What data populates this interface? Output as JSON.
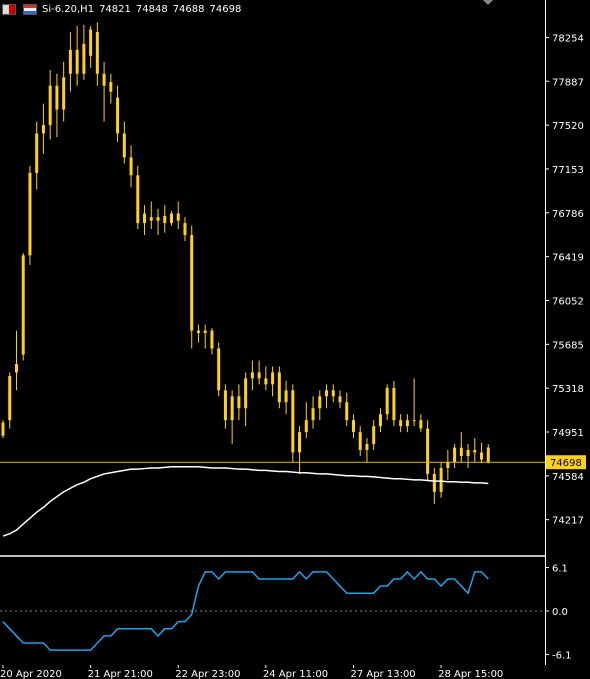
{
  "header": {
    "symbol": "Si-6.20,H1",
    "open": "74821",
    "high": "74848",
    "low": "74688",
    "close": "74698"
  },
  "colors": {
    "background": "#000000",
    "candle": "#ffd21a",
    "current_price_line": "#e6b800",
    "current_price_badge": "#ffd21a",
    "moving_average": "#ffffff",
    "indicator_line": "#1fa3e6",
    "axis_text": "#ffffff",
    "separator": "#ffffff"
  },
  "price_axis": {
    "ticks": [
      "78254",
      "77887",
      "77520",
      "77153",
      "76786",
      "76419",
      "76052",
      "75685",
      "75318",
      "74951",
      "74584",
      "74217"
    ],
    "current_price": "74698"
  },
  "indicator_axis": {
    "ticks": [
      "6.1",
      "0.0",
      "-6.1"
    ]
  },
  "time_axis": {
    "labels": [
      "20 Apr 2020",
      "21 Apr 21:00",
      "22 Apr 23:00",
      "24 Apr 11:00",
      "27 Apr 13:00",
      "28 Apr 15:00"
    ]
  },
  "chart_data": {
    "type": "candlestick",
    "timeframe": "H1",
    "ylim": [
      73980,
      78400
    ],
    "indicator_ylim": [
      -6.6,
      6.6
    ],
    "candles": [
      [
        74920,
        75050,
        74900,
        75030
      ],
      [
        75050,
        75450,
        74980,
        75420
      ],
      [
        75450,
        75800,
        75300,
        75520
      ],
      [
        75600,
        76450,
        75550,
        76430
      ],
      [
        76430,
        77180,
        76350,
        77120
      ],
      [
        77120,
        77550,
        76980,
        77450
      ],
      [
        77450,
        77700,
        77280,
        77520
      ],
      [
        77520,
        77980,
        77400,
        77850
      ],
      [
        77850,
        77950,
        77420,
        77650
      ],
      [
        77650,
        78050,
        77550,
        77920
      ],
      [
        77950,
        78300,
        77800,
        78150
      ],
      [
        78150,
        78350,
        77850,
        77950
      ],
      [
        77950,
        78360,
        77900,
        78200
      ],
      [
        78100,
        78350,
        78000,
        78320
      ],
      [
        78300,
        78380,
        77850,
        77950
      ],
      [
        77950,
        78050,
        77550,
        77850
      ],
      [
        77880,
        77950,
        77700,
        77800
      ],
      [
        77750,
        77850,
        77380,
        77450
      ],
      [
        77450,
        77550,
        77200,
        77250
      ],
      [
        77250,
        77350,
        77000,
        77100
      ],
      [
        77100,
        77180,
        76650,
        76700
      ],
      [
        76700,
        76850,
        76600,
        76780
      ],
      [
        76750,
        76880,
        76650,
        76720
      ],
      [
        76720,
        76820,
        76600,
        76750
      ],
      [
        76760,
        76850,
        76620,
        76700
      ],
      [
        76700,
        76800,
        76680,
        76780
      ],
      [
        76780,
        76880,
        76650,
        76720
      ],
      [
        76700,
        76750,
        76550,
        76600
      ],
      [
        76600,
        76680,
        75650,
        75800
      ],
      [
        75800,
        75850,
        75700,
        75780
      ],
      [
        75780,
        75850,
        75650,
        75800
      ],
      [
        75800,
        75820,
        75600,
        75650
      ],
      [
        75650,
        75700,
        75250,
        75300
      ],
      [
        75300,
        75350,
        74980,
        75050
      ],
      [
        75050,
        75300,
        74850,
        75250
      ],
      [
        75250,
        75350,
        75050,
        75150
      ],
      [
        75150,
        75450,
        75000,
        75400
      ],
      [
        75400,
        75550,
        75300,
        75450
      ],
      [
        75450,
        75550,
        75350,
        75400
      ],
      [
        75400,
        75500,
        75300,
        75350
      ],
      [
        75350,
        75500,
        75250,
        75450
      ],
      [
        75450,
        75500,
        75150,
        75200
      ],
      [
        75200,
        75380,
        75100,
        75300
      ],
      [
        75300,
        75350,
        74700,
        74780
      ],
      [
        74780,
        75000,
        74600,
        74950
      ],
      [
        74950,
        75200,
        74900,
        75050
      ],
      [
        75050,
        75250,
        74980,
        75150
      ],
      [
        75150,
        75300,
        75050,
        75250
      ],
      [
        75250,
        75350,
        75150,
        75300
      ],
      [
        75300,
        75350,
        75200,
        75250
      ],
      [
        75250,
        75300,
        75150,
        75200
      ],
      [
        75200,
        75280,
        75000,
        75050
      ],
      [
        75050,
        75100,
        74900,
        74950
      ],
      [
        74950,
        75000,
        74750,
        74800
      ],
      [
        74800,
        74900,
        74700,
        74850
      ],
      [
        74850,
        75050,
        74800,
        75000
      ],
      [
        75000,
        75150,
        74950,
        75100
      ],
      [
        75100,
        75350,
        75050,
        75320
      ],
      [
        75320,
        75380,
        75000,
        75050
      ],
      [
        75050,
        75100,
        74950,
        75000
      ],
      [
        75000,
        75100,
        74950,
        75050
      ],
      [
        75050,
        75400,
        75000,
        75050
      ],
      [
        75050,
        75100,
        74950,
        74980
      ],
      [
        74980,
        75050,
        74550,
        74600
      ],
      [
        74600,
        74650,
        74350,
        74450
      ],
      [
        74450,
        74700,
        74400,
        74650
      ],
      [
        74650,
        74800,
        74550,
        74700
      ],
      [
        74700,
        74850,
        74650,
        74820
      ],
      [
        74820,
        74950,
        74700,
        74750
      ],
      [
        74750,
        74850,
        74650,
        74800
      ],
      [
        74800,
        74900,
        74700,
        74780
      ],
      [
        74780,
        74860,
        74690,
        74720
      ],
      [
        74821,
        74848,
        74688,
        74698
      ]
    ],
    "moving_average": [
      74080,
      74100,
      74130,
      74180,
      74230,
      74280,
      74320,
      74370,
      74410,
      74450,
      74480,
      74510,
      74530,
      74560,
      74580,
      74600,
      74610,
      74620,
      74630,
      74640,
      74640,
      74645,
      74650,
      74650,
      74655,
      74660,
      74660,
      74660,
      74660,
      74660,
      74655,
      74650,
      74650,
      74650,
      74645,
      74640,
      74640,
      74635,
      74630,
      74630,
      74625,
      74620,
      74620,
      74615,
      74610,
      74610,
      74605,
      74600,
      74600,
      74595,
      74590,
      74585,
      74585,
      74580,
      74580,
      74575,
      74570,
      74565,
      74560,
      74560,
      74555,
      74550,
      74550,
      74545,
      74540,
      74540,
      74535,
      74535,
      74530,
      74530,
      74525,
      74525,
      74520
    ],
    "indicator_values": [
      -1.5,
      -2.5,
      -3.5,
      -4.5,
      -4.5,
      -4.5,
      -4.5,
      -5.5,
      -5.5,
      -5.5,
      -5.5,
      -5.5,
      -5.5,
      -5.5,
      -4.5,
      -3.5,
      -3.5,
      -2.5,
      -2.5,
      -2.5,
      -2.5,
      -2.5,
      -2.5,
      -3.5,
      -2.5,
      -2.5,
      -1.5,
      -1.5,
      -0.5,
      3.5,
      5.5,
      5.5,
      4.5,
      5.5,
      5.5,
      5.5,
      5.5,
      5.5,
      4.5,
      4.5,
      4.5,
      4.5,
      4.5,
      4.5,
      5.5,
      4.5,
      5.5,
      5.5,
      5.5,
      4.5,
      3.5,
      2.5,
      2.5,
      2.5,
      2.5,
      2.5,
      3.5,
      3.5,
      4.5,
      4.5,
      5.5,
      4.5,
      5.5,
      4.5,
      4.5,
      3.5,
      4.5,
      4.5,
      3.5,
      2.5,
      5.5,
      5.5,
      4.5
    ]
  }
}
